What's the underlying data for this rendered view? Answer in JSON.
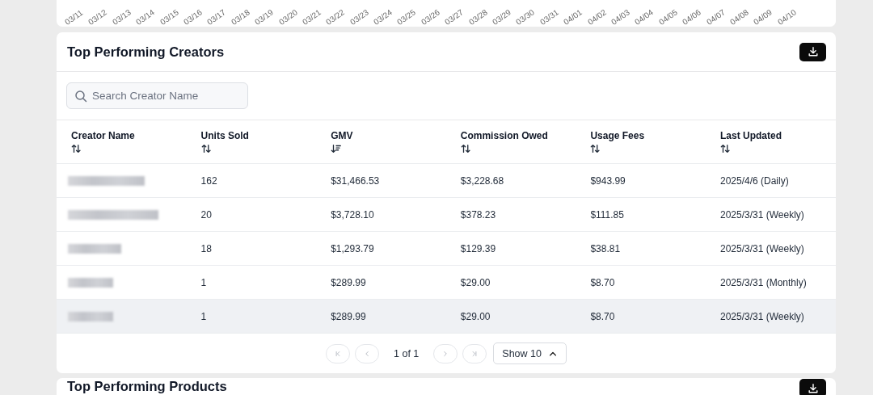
{
  "chart_axis_labels": [
    "03/11",
    "03/12",
    "03/13",
    "03/14",
    "03/15",
    "03/16",
    "03/17",
    "03/18",
    "03/19",
    "03/20",
    "03/21",
    "03/22",
    "03/23",
    "03/24",
    "03/25",
    "03/26",
    "03/27",
    "03/28",
    "03/29",
    "03/30",
    "03/31",
    "04/01",
    "04/02",
    "04/03",
    "04/04",
    "04/05",
    "04/06",
    "04/07",
    "04/08",
    "04/09",
    "04/10"
  ],
  "creators_card": {
    "title": "Top Performing Creators",
    "search": {
      "placeholder": "Search Creator Name"
    },
    "columns": [
      {
        "label": "Creator Name",
        "sorted_desc": false
      },
      {
        "label": "Units Sold",
        "sorted_desc": false
      },
      {
        "label": "GMV",
        "sorted_desc": true
      },
      {
        "label": "Commission Owed",
        "sorted_desc": false
      },
      {
        "label": "Usage Fees",
        "sorted_desc": false
      },
      {
        "label": "Last Updated",
        "sorted_desc": false
      }
    ],
    "rows": [
      {
        "redacted": true,
        "highlighted": false,
        "cells": [
          "",
          "162",
          "$31,466.53",
          "$3,228.68",
          "$943.99",
          "2025/4/6 (Daily)"
        ]
      },
      {
        "redacted": true,
        "highlighted": false,
        "cells": [
          "",
          "20",
          "$3,728.10",
          "$378.23",
          "$111.85",
          "2025/3/31 (Weekly)"
        ]
      },
      {
        "redacted": true,
        "highlighted": false,
        "cells": [
          "",
          "18",
          "$1,293.79",
          "$129.39",
          "$38.81",
          "2025/3/31 (Weekly)"
        ]
      },
      {
        "redacted": true,
        "highlighted": false,
        "cells": [
          "",
          "1",
          "$289.99",
          "$29.00",
          "$8.70",
          "2025/3/31 (Monthly)"
        ]
      },
      {
        "redacted": true,
        "highlighted": true,
        "cells": [
          "",
          "1",
          "$289.99",
          "$29.00",
          "$8.70",
          "2025/3/31 (Weekly)"
        ]
      }
    ],
    "pagination": {
      "buttons": [
        {
          "kind": "first",
          "disabled": true
        },
        {
          "kind": "prev",
          "disabled": true
        },
        {
          "kind": "page_info",
          "text": "1 of 1"
        },
        {
          "kind": "next",
          "disabled": true
        },
        {
          "kind": "last",
          "disabled": true
        }
      ],
      "page_size": "Show 10"
    }
  },
  "products_card": {
    "title": "Top Performing Products"
  }
}
